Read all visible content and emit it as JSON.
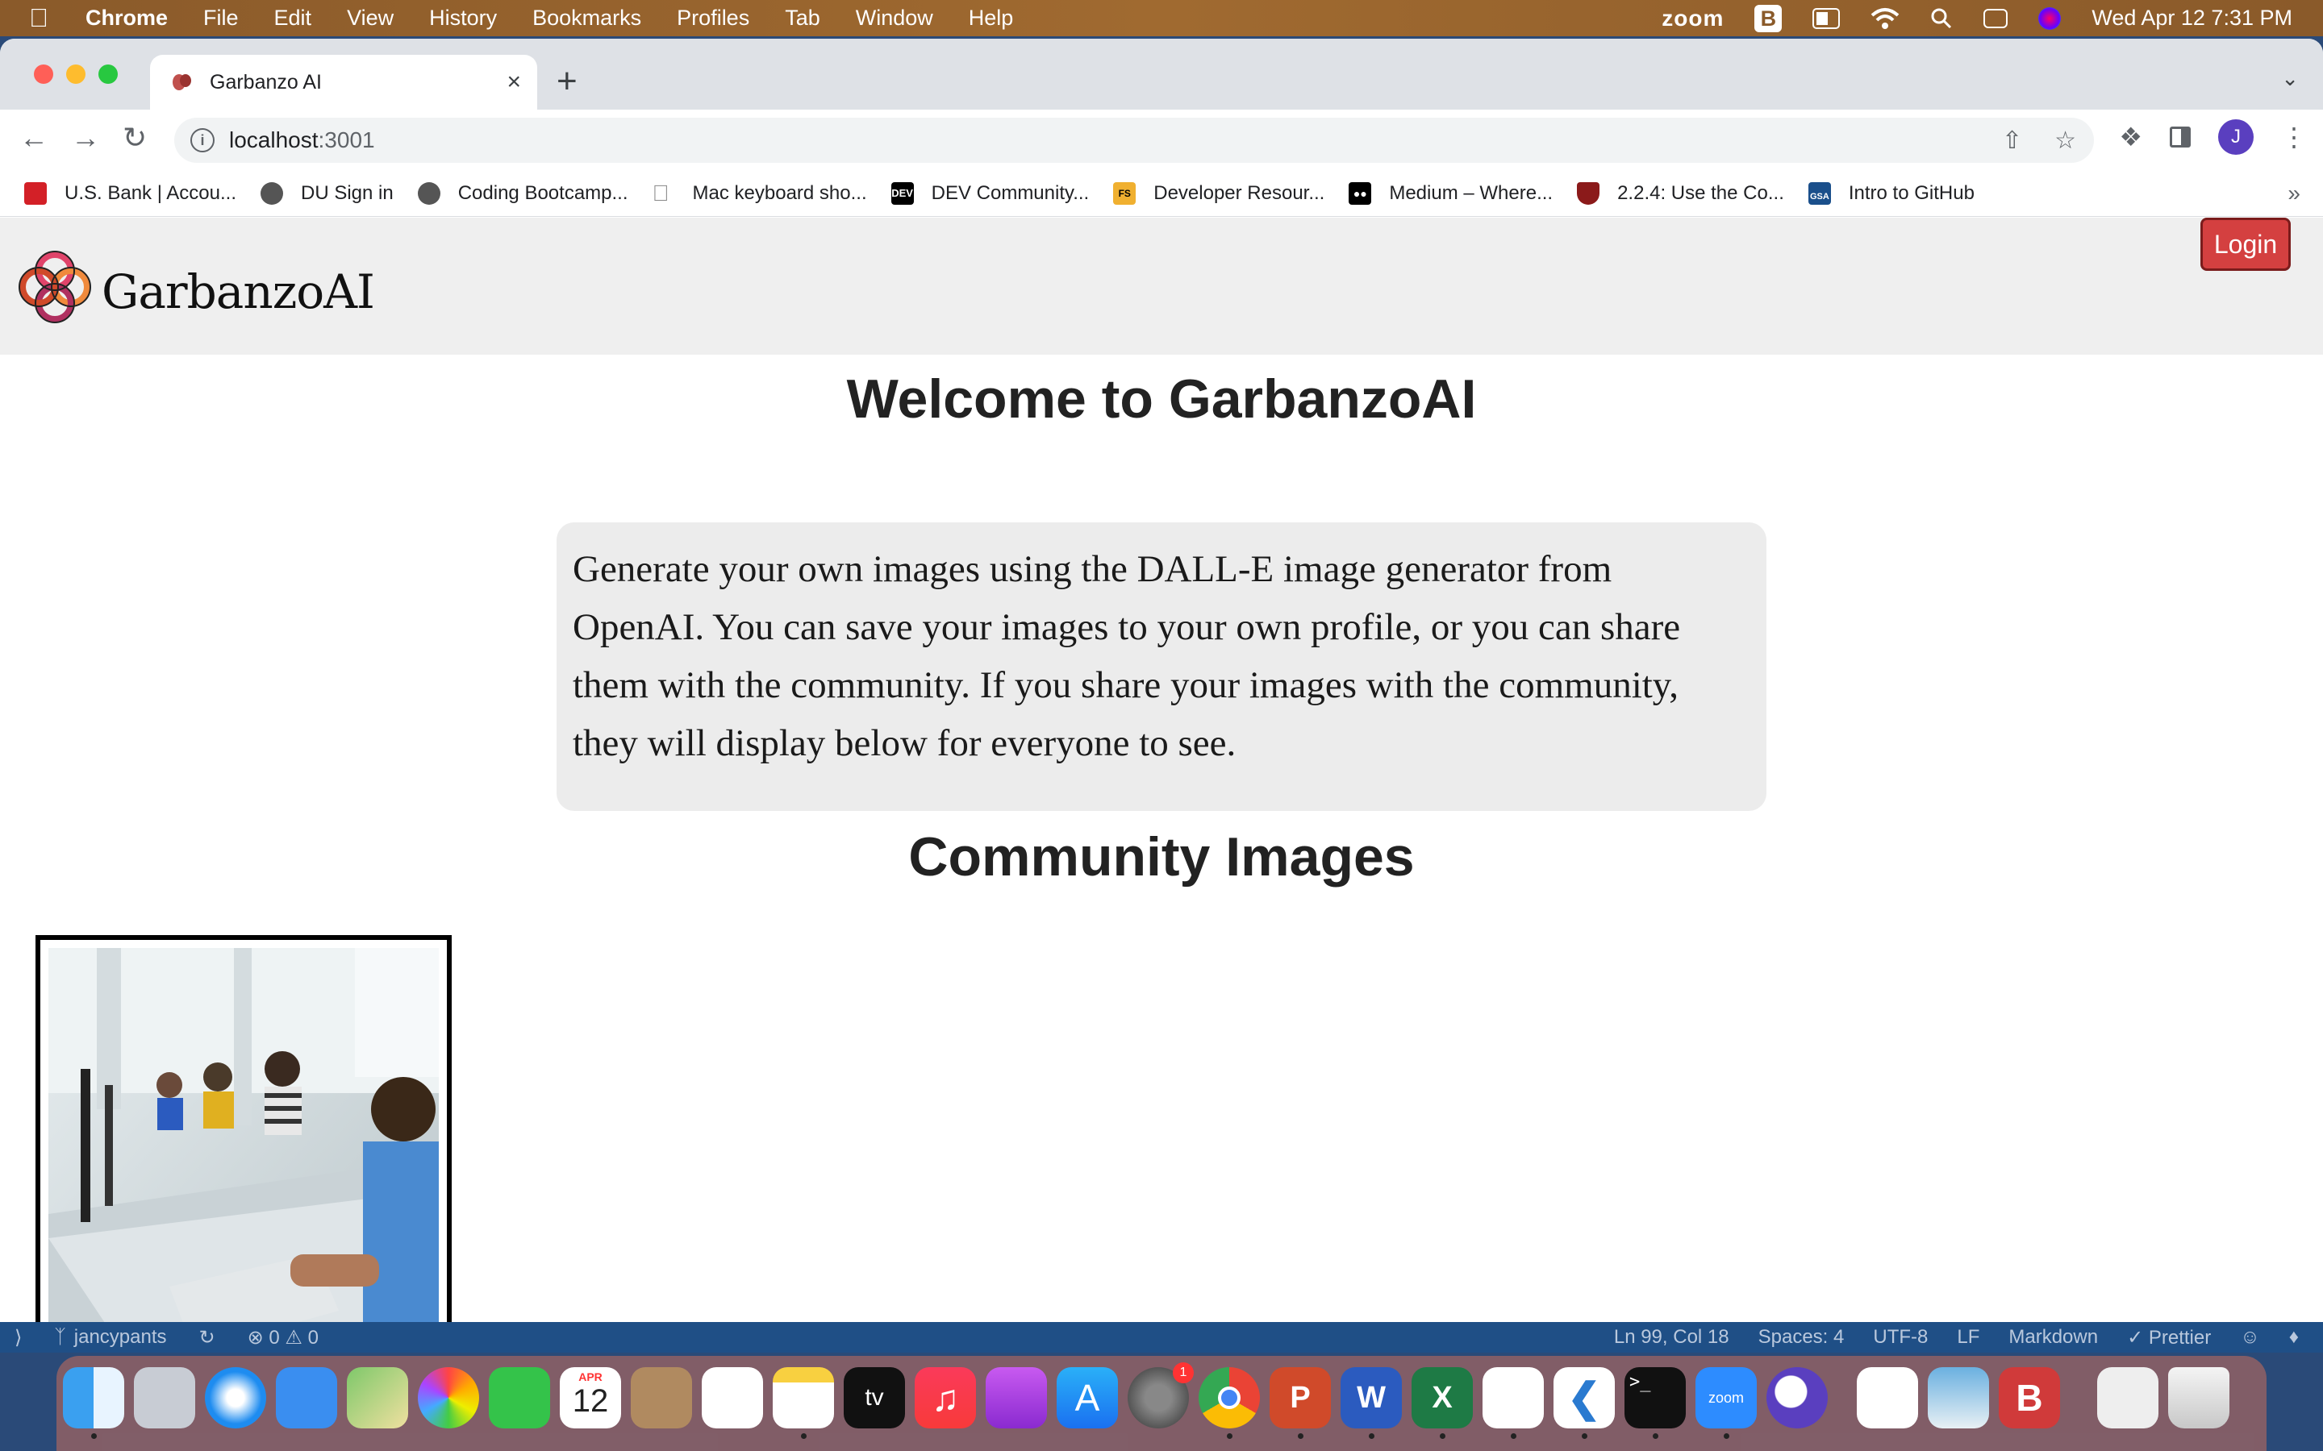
{
  "menubar": {
    "app_name": "Chrome",
    "items": [
      "File",
      "Edit",
      "View",
      "History",
      "Bookmarks",
      "Profiles",
      "Tab",
      "Window",
      "Help"
    ],
    "zoom_label": "zoom",
    "datetime": "Wed Apr 12  7:31 PM"
  },
  "browser": {
    "tab_title": "Garbanzo AI",
    "url_host": "localhost",
    "url_port": ":3001",
    "profile_initial": "J",
    "bookmarks": [
      {
        "label": "U.S. Bank | Accou...",
        "color": "#d32027"
      },
      {
        "label": "DU Sign in",
        "color": "#444444"
      },
      {
        "label": "Coding Bootcamp...",
        "color": "#444444"
      },
      {
        "label": "Mac keyboard sho...",
        "color": "#888888"
      },
      {
        "label": "DEV Community...",
        "color": "#000000"
      },
      {
        "label": "Developer Resour...",
        "color": "#f0b030"
      },
      {
        "label": "Medium – Where...",
        "color": "#000000"
      },
      {
        "label": "2.2.4: Use the Co...",
        "color": "#8b1a1a"
      },
      {
        "label": "Intro to GitHub",
        "color": "#1a4f8b"
      }
    ]
  },
  "site": {
    "logo_text": "GarbanzoAI",
    "login_label": "Login",
    "welcome_title": "Welcome to GarbanzoAI",
    "description": "Generate your own images using the DALL-E image generator from OpenAI. You can save your images to your own profile, or you can share them with the community. If you share your images with the community, they will display below for everyone to see.",
    "community_title": "Community Images"
  },
  "vscode_status": {
    "branch": "jancypants",
    "problems": "⊗ 0 ⚠ 0",
    "position": "Ln 99, Col 18",
    "spaces": "Spaces: 4",
    "encoding": "UTF-8",
    "eol": "LF",
    "language": "Markdown",
    "formatter": "✓ Prettier"
  },
  "dock": {
    "calendar_month": "APR",
    "calendar_day": "12",
    "settings_badge": "1",
    "tv_label": "tv",
    "zoom_label": "zoom",
    "word_letter": "W",
    "excel_letter": "X",
    "ppt_letter": "P",
    "b_letter": "B"
  }
}
